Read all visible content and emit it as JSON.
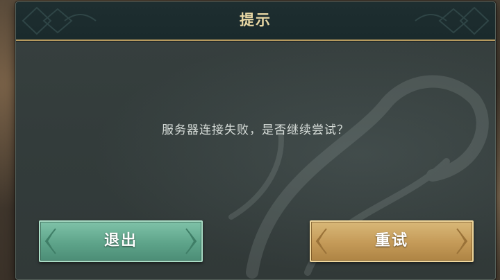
{
  "dialog": {
    "title": "提示",
    "message": "服务器连接失败，是否继续尝试？"
  },
  "buttons": {
    "exit_label": "退出",
    "retry_label": "重试"
  },
  "colors": {
    "title_text": "#e8d7a4",
    "title_border": "#b69a5e",
    "exit_button": "#5ea48a",
    "retry_button": "#c49a58",
    "message_text": "#d6dcd8"
  }
}
